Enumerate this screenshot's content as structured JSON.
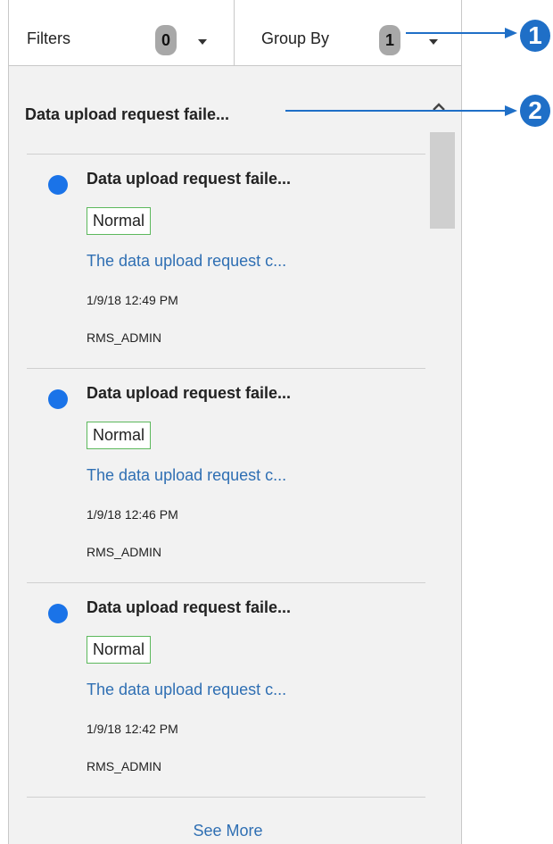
{
  "toolbar": {
    "filters_label": "Filters",
    "filters_count": "0",
    "groupby_label": "Group By",
    "groupby_count": "1"
  },
  "group": {
    "title": "Data upload request faile..."
  },
  "items": [
    {
      "title": "Data upload request faile...",
      "priority": "Normal",
      "description": "The data upload request c...",
      "time": "1/9/18 12:49 PM",
      "user": "RMS_ADMIN"
    },
    {
      "title": "Data upload request faile...",
      "priority": "Normal",
      "description": "The data upload request c...",
      "time": "1/9/18 12:46 PM",
      "user": "RMS_ADMIN"
    },
    {
      "title": "Data upload request faile...",
      "priority": "Normal",
      "description": "The data upload request c...",
      "time": "1/9/18 12:42 PM",
      "user": "RMS_ADMIN"
    }
  ],
  "see_more": "See More",
  "callouts": [
    "1",
    "2"
  ],
  "colors": {
    "accent": "#1f6fc7",
    "unread_dot": "#1a73e8",
    "link": "#2f6fb3",
    "badge_border": "#5cb85c"
  }
}
